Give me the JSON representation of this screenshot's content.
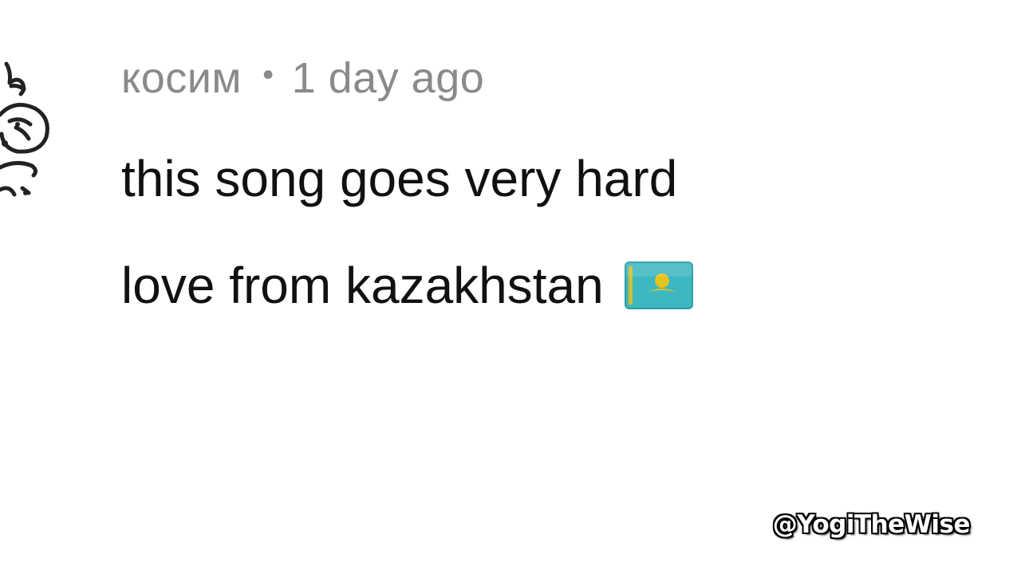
{
  "comment": {
    "author": "косим",
    "separator": "•",
    "timestamp": "1 day ago",
    "lines": [
      "this song goes very hard",
      "love from kazakhstan"
    ],
    "emoji_icon": "kazakhstan-flag-icon"
  },
  "avatar": {
    "icon": "sketch-avatar-icon"
  },
  "watermark": {
    "text": "@YogiTheWise"
  },
  "colors": {
    "background": "#ffffff",
    "meta_text": "#8a8a8a",
    "body_text": "#111111",
    "flag_field": "#3eb8c0",
    "flag_emblem": "#e7c21a"
  }
}
